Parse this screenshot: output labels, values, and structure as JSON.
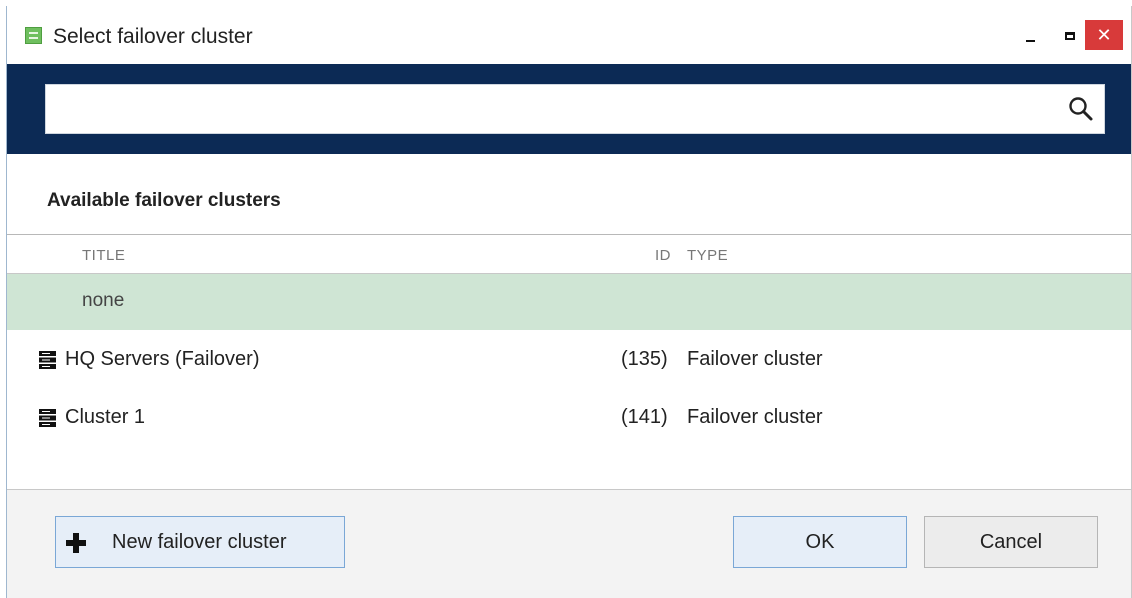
{
  "window": {
    "title": "Select failover cluster",
    "minimize_glyph": "minimize",
    "maximize_glyph": "maximize",
    "close_glyph": "✕"
  },
  "search": {
    "value": "",
    "placeholder": "",
    "icon": "search-icon"
  },
  "section": {
    "title": "Available failover clusters"
  },
  "table": {
    "columns": {
      "title": "TITLE",
      "id": "ID",
      "type": "TYPE"
    },
    "rows": [
      {
        "title": "none",
        "id": "",
        "type": "",
        "selected": true,
        "icon": ""
      },
      {
        "title": "HQ Servers (Failover)",
        "id": "(135)",
        "type": "Failover cluster",
        "selected": false,
        "icon": "server-icon"
      },
      {
        "title": "Cluster 1",
        "id": "(141)",
        "type": "Failover cluster",
        "selected": false,
        "icon": "server-icon"
      }
    ]
  },
  "buttons": {
    "new_cluster": "New failover cluster",
    "ok": "OK",
    "cancel": "Cancel"
  },
  "colors": {
    "header_band": "#0c2a55",
    "selected_row": "#cfe5d4",
    "close_button": "#d83a3a",
    "primary_button_border": "#7aa7d6"
  }
}
